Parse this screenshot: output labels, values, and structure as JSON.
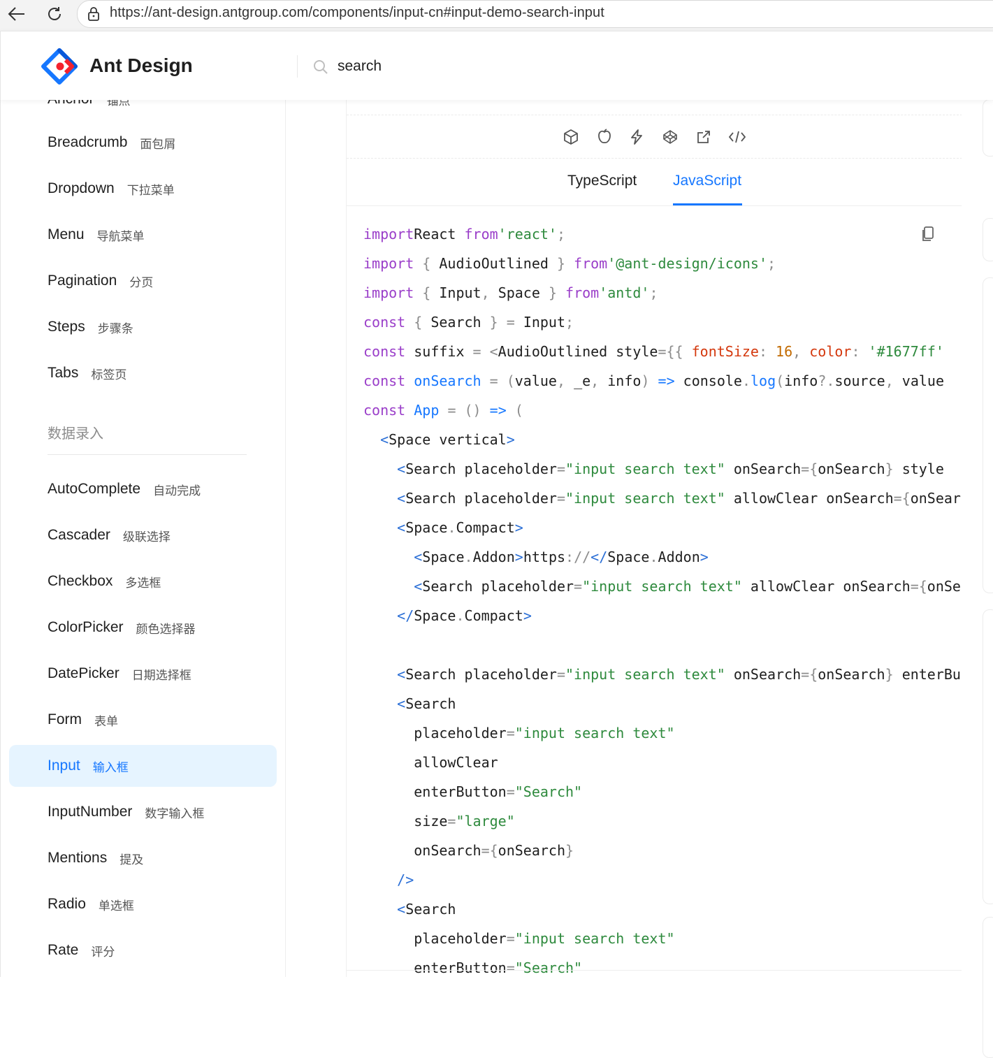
{
  "browser": {
    "url": "https://ant-design.antgroup.com/components/input-cn#input-demo-search-input"
  },
  "header": {
    "brand": "Ant Design",
    "search_value": "search"
  },
  "sidebar": {
    "partial_item": {
      "en": "Anchor",
      "zh": "锚点"
    },
    "nav_items": [
      {
        "en": "Breadcrumb",
        "zh": "面包屑"
      },
      {
        "en": "Dropdown",
        "zh": "下拉菜单"
      },
      {
        "en": "Menu",
        "zh": "导航菜单"
      },
      {
        "en": "Pagination",
        "zh": "分页"
      },
      {
        "en": "Steps",
        "zh": "步骤条"
      },
      {
        "en": "Tabs",
        "zh": "标签页"
      }
    ],
    "group_title": "数据录入",
    "entry_items": [
      {
        "en": "AutoComplete",
        "zh": "自动完成"
      },
      {
        "en": "Cascader",
        "zh": "级联选择"
      },
      {
        "en": "Checkbox",
        "zh": "多选框"
      },
      {
        "en": "ColorPicker",
        "zh": "颜色选择器"
      },
      {
        "en": "DatePicker",
        "zh": "日期选择框"
      },
      {
        "en": "Form",
        "zh": "表单"
      },
      {
        "en": "Input",
        "zh": "输入框",
        "active": true
      },
      {
        "en": "InputNumber",
        "zh": "数字输入框"
      },
      {
        "en": "Mentions",
        "zh": "提及"
      },
      {
        "en": "Radio",
        "zh": "单选框"
      },
      {
        "en": "Rate",
        "zh": "评分"
      }
    ]
  },
  "demo": {
    "action_icons": [
      "codesandbox-icon",
      "codepen-icon",
      "stackblitz-icon",
      "codeblock-icon",
      "external-link-icon",
      "code-expand-icon"
    ],
    "tabs": [
      {
        "label": "TypeScript",
        "active": false
      },
      {
        "label": "JavaScript",
        "active": true
      }
    ],
    "code_lines": [
      [
        [
          "kw",
          "import"
        ],
        [
          "",
          "React "
        ],
        [
          "kw",
          "from"
        ],
        [
          "str",
          "'react'"
        ],
        [
          "p",
          ";"
        ]
      ],
      [
        [
          "kw",
          "import"
        ],
        [
          "p",
          " { "
        ],
        [
          "",
          "AudioOutlined"
        ],
        [
          "p",
          " } "
        ],
        [
          "kw",
          "from"
        ],
        [
          "str",
          "'@ant-design/icons'"
        ],
        [
          "p",
          ";"
        ]
      ],
      [
        [
          "kw",
          "import"
        ],
        [
          "p",
          " { "
        ],
        [
          "",
          "Input"
        ],
        [
          "p",
          ", "
        ],
        [
          "",
          "Space"
        ],
        [
          "p",
          " } "
        ],
        [
          "kw",
          "from"
        ],
        [
          "str",
          "'antd'"
        ],
        [
          "p",
          ";"
        ]
      ],
      [
        [
          "kw",
          "const"
        ],
        [
          "p",
          " { "
        ],
        [
          "",
          "Search"
        ],
        [
          "p",
          " } "
        ],
        [
          "p",
          "= "
        ],
        [
          "",
          "Input"
        ],
        [
          "p",
          ";"
        ]
      ],
      [
        [
          "kw",
          "const"
        ],
        [
          "",
          " suffix "
        ],
        [
          "p",
          "= <"
        ],
        [
          "",
          "AudioOutlined style"
        ],
        [
          "p",
          "={{ "
        ],
        [
          "attr",
          "fontSize"
        ],
        [
          "p",
          ": "
        ],
        [
          "num",
          "16"
        ],
        [
          "p",
          ", "
        ],
        [
          "attr",
          "color"
        ],
        [
          "p",
          ": "
        ],
        [
          "str",
          "'#1677ff'"
        ]
      ],
      [
        [
          "kw",
          "const"
        ],
        [
          "fn",
          " onSearch "
        ],
        [
          "p",
          "= ("
        ],
        [
          "",
          "value"
        ],
        [
          "p",
          ", "
        ],
        [
          "",
          "_e"
        ],
        [
          "p",
          ", "
        ],
        [
          "",
          "info"
        ],
        [
          "p",
          ") "
        ],
        [
          "fn",
          "=>"
        ],
        [
          "",
          " console"
        ],
        [
          "p",
          "."
        ],
        [
          "fn",
          "log"
        ],
        [
          "p",
          "("
        ],
        [
          "",
          "info"
        ],
        [
          "p",
          "?."
        ],
        [
          "",
          "source"
        ],
        [
          "p",
          ", "
        ],
        [
          "",
          "value"
        ]
      ],
      [
        [
          "kw",
          "const"
        ],
        [
          "fn",
          " App "
        ],
        [
          "p",
          "= () "
        ],
        [
          "fn",
          "=>"
        ],
        [
          "p",
          " ("
        ]
      ],
      [
        [
          "",
          "  "
        ],
        [
          "tag",
          "<"
        ],
        [
          "",
          "Space vertical"
        ],
        [
          "tag",
          ">"
        ]
      ],
      [
        [
          "",
          "    "
        ],
        [
          "tag",
          "<"
        ],
        [
          "",
          "Search placeholder"
        ],
        [
          "p",
          "="
        ],
        [
          "str",
          "\"input search text\""
        ],
        [
          "",
          " onSearch"
        ],
        [
          "p",
          "={"
        ],
        [
          "",
          "onSearch"
        ],
        [
          "p",
          "} "
        ],
        [
          "",
          "style"
        ]
      ],
      [
        [
          "",
          "    "
        ],
        [
          "tag",
          "<"
        ],
        [
          "",
          "Search placeholder"
        ],
        [
          "p",
          "="
        ],
        [
          "str",
          "\"input search text\""
        ],
        [
          "",
          " allowClear onSearch"
        ],
        [
          "p",
          "={"
        ],
        [
          "",
          "onSearch"
        ]
      ],
      [
        [
          "",
          "    "
        ],
        [
          "tag",
          "<"
        ],
        [
          "",
          "Space"
        ],
        [
          "p",
          "."
        ],
        [
          "",
          "Compact"
        ],
        [
          "tag",
          ">"
        ]
      ],
      [
        [
          "",
          "      "
        ],
        [
          "tag",
          "<"
        ],
        [
          "",
          "Space"
        ],
        [
          "p",
          "."
        ],
        [
          "",
          "Addon"
        ],
        [
          "tag",
          ">"
        ],
        [
          "",
          "https"
        ],
        [
          "p",
          "://"
        ],
        [
          "tag",
          "</"
        ],
        [
          "",
          "Space"
        ],
        [
          "p",
          "."
        ],
        [
          "",
          "Addon"
        ],
        [
          "tag",
          ">"
        ]
      ],
      [
        [
          "",
          "      "
        ],
        [
          "tag",
          "<"
        ],
        [
          "",
          "Search placeholder"
        ],
        [
          "p",
          "="
        ],
        [
          "str",
          "\"input search text\""
        ],
        [
          "",
          " allowClear onSearch"
        ],
        [
          "p",
          "={"
        ],
        [
          "",
          "onSearch"
        ]
      ],
      [
        [
          "",
          "    "
        ],
        [
          "tag",
          "</"
        ],
        [
          "",
          "Space"
        ],
        [
          "p",
          "."
        ],
        [
          "",
          "Compact"
        ],
        [
          "tag",
          ">"
        ]
      ],
      [
        [
          "",
          ""
        ]
      ],
      [
        [
          "",
          "    "
        ],
        [
          "tag",
          "<"
        ],
        [
          "",
          "Search placeholder"
        ],
        [
          "p",
          "="
        ],
        [
          "str",
          "\"input search text\""
        ],
        [
          "",
          " onSearch"
        ],
        [
          "p",
          "={"
        ],
        [
          "",
          "onSearch"
        ],
        [
          "p",
          "} "
        ],
        [
          "",
          "enterButton"
        ]
      ],
      [
        [
          "",
          "    "
        ],
        [
          "tag",
          "<"
        ],
        [
          "",
          "Search"
        ]
      ],
      [
        [
          "",
          "      placeholder"
        ],
        [
          "p",
          "="
        ],
        [
          "str",
          "\"input search text\""
        ]
      ],
      [
        [
          "",
          "      allowClear"
        ]
      ],
      [
        [
          "",
          "      enterButton"
        ],
        [
          "p",
          "="
        ],
        [
          "str",
          "\"Search\""
        ]
      ],
      [
        [
          "",
          "      size"
        ],
        [
          "p",
          "="
        ],
        [
          "str",
          "\"large\""
        ]
      ],
      [
        [
          "",
          "      onSearch"
        ],
        [
          "p",
          "={"
        ],
        [
          "",
          "onSearch"
        ],
        [
          "p",
          "}"
        ]
      ],
      [
        [
          "",
          "    "
        ],
        [
          "tag",
          "/>"
        ]
      ],
      [
        [
          "",
          "    "
        ],
        [
          "tag",
          "<"
        ],
        [
          "",
          "Search"
        ]
      ],
      [
        [
          "",
          "      placeholder"
        ],
        [
          "p",
          "="
        ],
        [
          "str",
          "\"input search text\""
        ]
      ],
      [
        [
          "",
          "      enterButton"
        ],
        [
          "p",
          "="
        ],
        [
          "str",
          "\"Search\""
        ]
      ]
    ]
  },
  "colors": {
    "primary": "#1677ff",
    "active_bg": "#e6f4ff",
    "keyword": "#9a3ec9",
    "string": "#2e8a3d"
  }
}
